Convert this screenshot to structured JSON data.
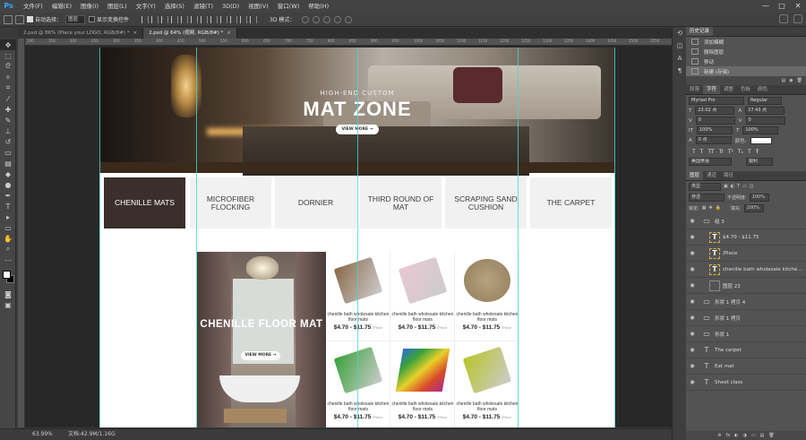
{
  "app": {
    "logo": "Ps"
  },
  "menu": [
    "文件(F)",
    "编辑(E)",
    "图像(I)",
    "图层(L)",
    "文字(Y)",
    "选择(S)",
    "滤镜(T)",
    "3D(D)",
    "视图(V)",
    "窗口(W)",
    "帮助(H)"
  ],
  "window_controls": [
    "—",
    "□",
    "✕"
  ],
  "options": {
    "auto_select_label": "自动选择：",
    "auto_select_value": "图层",
    "show_transform_label": "显示变换控件",
    "mode3d_label": "3D 模式："
  },
  "tabs": [
    {
      "label": "2.psd @ 86% (Place your LOGO, RGB/8#) *",
      "close": "×"
    },
    {
      "label": "2.psd @ 64% (视频, RGB/8#) *",
      "close": "×"
    }
  ],
  "ruler_ticks": [
    "100",
    "150",
    "200",
    "250",
    "300",
    "350",
    "400",
    "450",
    "500",
    "550",
    "600",
    "650",
    "700",
    "750",
    "800",
    "850",
    "900",
    "950",
    "1000",
    "1050",
    "1100",
    "1150",
    "1200",
    "1250",
    "1300",
    "1350",
    "1400",
    "1450",
    "1500",
    "1550"
  ],
  "hero": {
    "subtitle": "HIGH-END CUSTOM",
    "title": "MAT ZONE",
    "button": "VIEW MORE →"
  },
  "categories": [
    {
      "label": "CHENILLE MATS",
      "active": true
    },
    {
      "label": "MICROFIBER FLOCKING",
      "active": false
    },
    {
      "label": "DORNIER",
      "active": false
    },
    {
      "label": "THIRD ROUND OF MAT",
      "active": false
    },
    {
      "label": "SCRAPING SAND CUSHION",
      "active": false
    },
    {
      "label": "THE CARPET",
      "active": false
    }
  ],
  "promo": {
    "title": "CHENILLE FLOOR MAT",
    "button": "VIEW MORE →"
  },
  "products": [
    {
      "name": "chenille bath wholesale kitchen floor mats",
      "price": "$4.70 - $11.75",
      "per": "/Piece",
      "color": "#8a6a4a"
    },
    {
      "name": "chenille bath wholesale kitchen floor mats",
      "price": "$4.70 - $11.75",
      "per": "/Piece",
      "color": "#e8c8d2"
    },
    {
      "name": "chenille bath wholesale kitchen floor mats",
      "price": "$4.70 - $11.75",
      "per": "/Piece",
      "color": "#b8a27e"
    },
    {
      "name": "chenille bath wholesale kitchen floor mats",
      "price": "$4.70 - $11.75",
      "per": "/Piece",
      "color": "#3aa23a"
    },
    {
      "name": "chenille bath wholesale kitchen floor mats",
      "price": "$4.70 - $11.75",
      "per": "/Piece",
      "color": "#d84a2a"
    },
    {
      "name": "chenille bath wholesale kitchen floor mats",
      "price": "$4.70 - $11.75",
      "per": "/Piece",
      "color": "#b8c42a"
    }
  ],
  "status": {
    "zoom": "63.99%",
    "doc": "文档:42.9M/1.16G"
  },
  "history": {
    "tab": "历史记录",
    "items": [
      {
        "label": "添加模糊",
        "selected": false
      },
      {
        "label": "删除图层",
        "selected": false
      },
      {
        "label": "移动",
        "selected": false
      },
      {
        "label": "新建 (存储)",
        "selected": true
      }
    ]
  },
  "char_tabs": [
    "段落",
    "字符",
    "调整",
    "色板",
    "颜色"
  ],
  "character": {
    "font": "Myriad Pro",
    "style": "Regular",
    "size": "23.02 点",
    "leading": "27.43 点",
    "kerning": "0",
    "tracking": "0",
    "vscale": "100%",
    "hscale": "100%",
    "baseline": "0 点",
    "color_label": "颜色:",
    "lang": "美国英语",
    "aa": "锐利",
    "type_icons": [
      "T",
      "T",
      "TT",
      "Tr",
      "T¹",
      "T₁",
      "T",
      "Ŧ"
    ]
  },
  "layer_tabs": [
    "图层",
    "通道",
    "路径"
  ],
  "layer_filter": {
    "kind": "类型",
    "blend": "穿透",
    "opacity_label": "不透明度:",
    "opacity": "100%",
    "lock_label": "锁定:",
    "fill_label": "填充:",
    "fill": "100%"
  },
  "layers": [
    {
      "name": "组 3",
      "type": "group"
    },
    {
      "name": "$4.70 - $11.75",
      "type": "text"
    },
    {
      "name": "/Piece",
      "type": "text"
    },
    {
      "name": "chenille bath wholesale  kitche...",
      "type": "text"
    },
    {
      "name": "图层 23",
      "type": "pixel"
    },
    {
      "name": "形状 1 拷贝 4",
      "type": "shape"
    },
    {
      "name": "形状 1 拷贝",
      "type": "shape"
    },
    {
      "name": "形状 1",
      "type": "shape"
    },
    {
      "name": "The carpet",
      "type": "text"
    },
    {
      "name": "Eat mat",
      "type": "text"
    },
    {
      "name": "Sheet class",
      "type": "text"
    }
  ],
  "layer_footer": [
    "⊛",
    "fx",
    "◐",
    "◑",
    "▭",
    "▤",
    "🗑"
  ]
}
